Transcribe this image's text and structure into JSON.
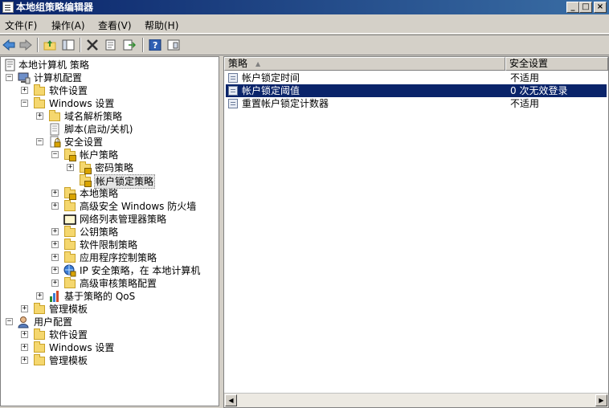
{
  "window": {
    "title": "本地组策略编辑器"
  },
  "titlebar_buttons": [
    "_",
    "□",
    "×"
  ],
  "menu": [
    "文件(F)",
    "操作(A)",
    "查看(V)",
    "帮助(H)"
  ],
  "tree": [
    {
      "label": "本地计算机 策略",
      "icon": "computer-policy-icon",
      "expander": ""
    },
    {
      "label": "计算机配置",
      "icon": "computer-icon",
      "expander": "−"
    },
    {
      "label": "软件设置",
      "icon": "folder-icon",
      "expander": "+"
    },
    {
      "label": "Windows 设置",
      "icon": "folder-icon",
      "expander": "−"
    },
    {
      "label": "域名解析策略",
      "icon": "folder-icon",
      "expander": "+"
    },
    {
      "label": "脚本(启动/关机)",
      "icon": "script-icon",
      "expander": ""
    },
    {
      "label": "安全设置",
      "icon": "security-icon",
      "expander": "−"
    },
    {
      "label": "帐户策略",
      "icon": "folder-lock-icon",
      "expander": "−"
    },
    {
      "label": "密码策略",
      "icon": "folder-lock-icon",
      "expander": "+"
    },
    {
      "label": "帐户锁定策略",
      "icon": "folder-lock-icon",
      "expander": ""
    },
    {
      "label": "本地策略",
      "icon": "folder-lock-icon",
      "expander": "+"
    },
    {
      "label": "高级安全 Windows 防火墙",
      "icon": "folder-icon",
      "expander": "+"
    },
    {
      "label": "网络列表管理器策略",
      "icon": "folder-black-icon",
      "expander": ""
    },
    {
      "label": "公钥策略",
      "icon": "folder-icon",
      "expander": "+"
    },
    {
      "label": "软件限制策略",
      "icon": "folder-icon",
      "expander": "+"
    },
    {
      "label": "应用程序控制策略",
      "icon": "folder-icon",
      "expander": "+"
    },
    {
      "label": "IP 安全策略，在 本地计算机",
      "icon": "ip-security-icon",
      "expander": "+"
    },
    {
      "label": "高级审核策略配置",
      "icon": "folder-icon",
      "expander": "+"
    },
    {
      "label": "基于策略的 QoS",
      "icon": "qos-chart-icon",
      "expander": "+"
    },
    {
      "label": "管理模板",
      "icon": "folder-icon",
      "expander": "+"
    },
    {
      "label": "用户配置",
      "icon": "user-icon",
      "expander": "−"
    },
    {
      "label": "软件设置",
      "icon": "folder-icon",
      "expander": "+"
    },
    {
      "label": "Windows 设置",
      "icon": "folder-icon",
      "expander": "+"
    },
    {
      "label": "管理模板",
      "icon": "folder-icon",
      "expander": "+"
    }
  ],
  "list": {
    "columns": [
      "策略",
      "安全设置"
    ],
    "rows": [
      {
        "policy": "帐户锁定时间",
        "setting": "不适用"
      },
      {
        "policy": "帐户锁定阈值",
        "setting": "0 次无效登录"
      },
      {
        "policy": "重置帐户锁定计数器",
        "setting": "不适用"
      }
    ]
  },
  "colors": {
    "titlebar": "#0a246a",
    "selection": "#0a246a",
    "folder": "#f5d76e"
  }
}
